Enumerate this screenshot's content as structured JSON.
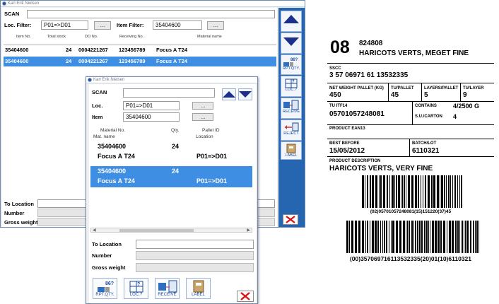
{
  "back_window": {
    "title": "Karl Erik Nielsen",
    "scan_label": "SCAN",
    "loc_filter_label": "Loc. Filter:",
    "loc_filter_value": "P01=>D01",
    "item_filter_label": "Item Filter:",
    "item_filter_value": "35404600",
    "dots": "...",
    "columns": [
      "Item No.",
      "Total stock",
      "DO No.",
      "Receiving No.",
      "Material name"
    ],
    "rows": [
      {
        "item": "35404600",
        "stock": "24",
        "do": "0004221267",
        "recv": "123456789",
        "name": "Focus A T24"
      },
      {
        "item": "35404600",
        "stock": "24",
        "do": "0004221267",
        "recv": "123456789",
        "name": "Focus A T24"
      }
    ],
    "to_location_label": "To Location",
    "number_label": "Number",
    "gross_weight_label": "Gross weight"
  },
  "side_buttons": {
    "rpt_qty": "RPT.QTY.",
    "loc": "LOC.?",
    "receive": "RECEIVE",
    "reject": "REJECT",
    "label": "LABEL",
    "qty_badge": "86?"
  },
  "front_window": {
    "title": "Karl Erik Nielsen",
    "scan_label": "SCAN",
    "loc_label": "Loc.",
    "loc_value": "P01=>D01",
    "item_label": "Item",
    "item_value": "35404600",
    "dots": "...",
    "hdr_matno": "Material No.",
    "hdr_qty": "Qty.",
    "hdr_pallet": "Pallet ID",
    "hdr_matname": "Mat. name",
    "hdr_location": "Location",
    "rows": [
      {
        "matno": "35404600",
        "qty": "24",
        "name": "Focus A T24",
        "loc": "P01=>D01"
      },
      {
        "matno": "35404600",
        "qty": "24",
        "name": "Focus A T24",
        "loc": "P01=>D01"
      }
    ],
    "to_location_label": "To Location",
    "number_label": "Number",
    "gross_weight_label": "Gross weight",
    "btn_rpt": "RPT.QTY.",
    "btn_loc": "LOC.?",
    "btn_receive": "RECEIVE",
    "btn_label": "LABEL",
    "qty_badge": "86?"
  },
  "label": {
    "big_num": "08",
    "code": "824808",
    "product": "HARICOTS VERTS, MEGET FINE",
    "sscc_lbl": "SSCC",
    "sscc": "3 57 06971 61 13532335",
    "nwp_lbl": "NET WEIGHT PALLET (KG)",
    "nwp": "450",
    "tu_pallet_lbl": "TU/PALLET",
    "tu_pallet": "45",
    "layers_lbl": "LAYERS/PALLET",
    "layers": "5",
    "tu_layer_lbl": "TU/LAYER",
    "tu_layer": "9",
    "tu_itf_lbl": "TU ITF14",
    "tu_itf": "05701057248081",
    "contains_lbl": "CONTAINS",
    "contains": "4/2500 G",
    "su_carton_lbl": "S.U./CARTON",
    "su_carton": "4",
    "ean_lbl": "PRODUCT EAN13",
    "best_before_lbl": "BEST BEFORE",
    "best_before": "15/05/2012",
    "batch_lbl": "BATCH/LOT",
    "batch": "6110321",
    "desc_lbl": "PRODUCT DESCRIPTION",
    "desc": "HARICOTS VERTS, VERY FINE",
    "barcode1_text": "(02)05701057248081(15)151220(37)45",
    "barcode2_text": "(00)357069716113532335(20)01(10)6110321"
  }
}
